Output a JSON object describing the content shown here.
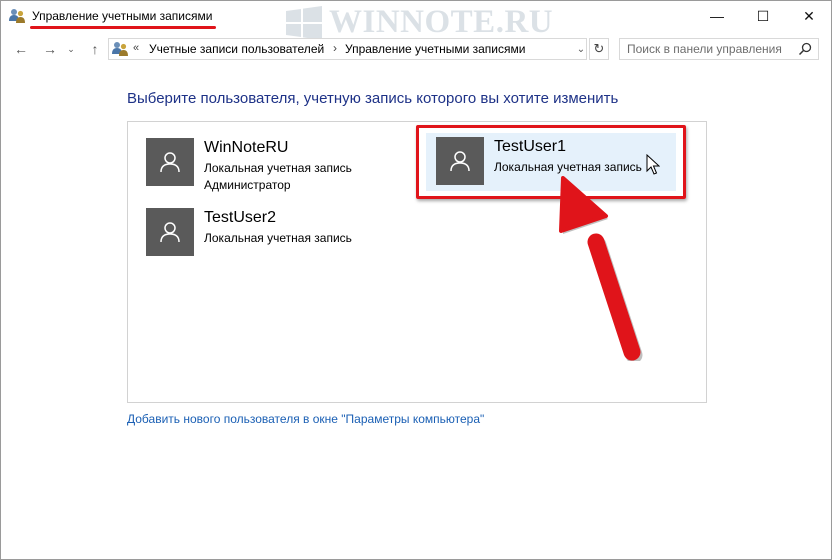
{
  "window": {
    "title": "Управление учетными записями",
    "watermark": "WINNOTE.RU",
    "controls": {
      "minimize": "—",
      "maximize": "☐",
      "close": "✕"
    }
  },
  "nav": {
    "back": "←",
    "forward": "→",
    "recent": "⌄",
    "up": "↑",
    "address": {
      "overflow": "«",
      "crumbs": [
        "Учетные записи пользователей",
        "Управление учетными записями"
      ],
      "separator": "›",
      "dropdown": "⌄"
    },
    "refresh": "↻",
    "search": {
      "placeholder": "Поиск в панели управления"
    }
  },
  "main": {
    "heading": "Выберите пользователя, учетную запись которого вы хотите изменить",
    "accounts": [
      {
        "name": "WinNoteRU",
        "type": "Локальная учетная запись",
        "role": "Администратор"
      },
      {
        "name": "TestUser1",
        "type": "Локальная учетная запись",
        "highlighted": true
      },
      {
        "name": "TestUser2",
        "type": "Локальная учетная запись"
      }
    ],
    "add_user_link": "Добавить нового пользователя в окне \"Параметры компьютера\""
  },
  "colors": {
    "heading": "#1e3287",
    "link": "#1a5fb4",
    "avatar": "#5a5a5a",
    "highlight": "#e5f1fb",
    "annotation_red": "#e0141a"
  },
  "icons": [
    "users-icon",
    "windows-logo-icon",
    "user-avatar-icon",
    "search-icon",
    "mouse-cursor-icon",
    "annotation-arrow-icon"
  ]
}
